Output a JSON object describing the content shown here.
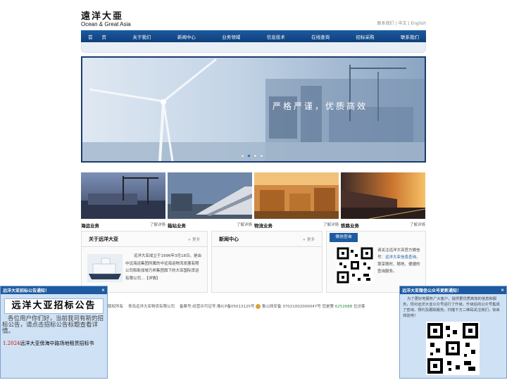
{
  "header": {
    "logo_cn": "遠洋大亜",
    "logo_en": "Ocean & Great Asia",
    "contact": "联系我们",
    "lang_cn": "中文",
    "lang_en": "English",
    "sep": "|"
  },
  "nav": {
    "items": [
      "首　　页",
      "关于我们",
      "新闻中心",
      "业务领域",
      "信息技术",
      "在线查询",
      "招标采购",
      "联系我们"
    ]
  },
  "banner": {
    "slogan": "严格严谨，优质高效",
    "slides": 4,
    "active_slide": 2
  },
  "business": {
    "items": [
      {
        "title": "海运业务",
        "more": "了解详情"
      },
      {
        "title": "箱站业务",
        "more": "了解详情"
      },
      {
        "title": "物流业务",
        "more": "了解详情"
      },
      {
        "title": "铁路业务",
        "more": "了解详情"
      }
    ]
  },
  "about": {
    "title": "关于远洋大亚",
    "more": "+ 更多",
    "text": "远洋大亚成立于1996年3月18日，是由中远海运集团所属的中远海运物流发展有限公司和新加坡万邦集团旗下的大亚国际货运有限公司...【详情】"
  },
  "news": {
    "title": "新闻中心",
    "more": "+ 更多"
  },
  "wechat": {
    "tab": "微信查询",
    "text_a": "请关注远洋大亚官方微信号：",
    "text_link": "远洋大亚信息查询",
    "text_b": "，尊享随时、随地、便捷的查询服务。"
  },
  "footer": {
    "copyright": "版权所有",
    "company": "青岛远洋大亚物流有限公司",
    "icp": "备案号:经营许可证号:鲁ICP备05013125号",
    "police": "鲁公网安备 37021002000047号 您是第",
    "count": "6252688",
    "visitor": "位访客"
  },
  "popup_left": {
    "header": "远洋大亚招标公告通知！",
    "close": "×",
    "title": "远洋大亚招标公告",
    "message": "各位用户你们好，当前我司有新的招标公告，请点击招标公告标题查看详情。",
    "link_num": "1.2024",
    "link_text": "远洋大亚傍海中路场地租赁招标书"
  },
  "popup_right": {
    "header": "远洋大亚微信公众号更新通知！",
    "close": "×",
    "message": "为了更好地服务广大客户，提供更优质高效的信息和服务，现对远洋大亚公众号进行了升级，升级后的公众号集成了查询、预约及跟踪服务。扫描下方二维码关注我们，快来体验吧！"
  },
  "colors": {
    "nav_blue": "#1d5aa1",
    "popup_bg": "#cfe1f5",
    "counter_green": "#2b8a3e"
  }
}
